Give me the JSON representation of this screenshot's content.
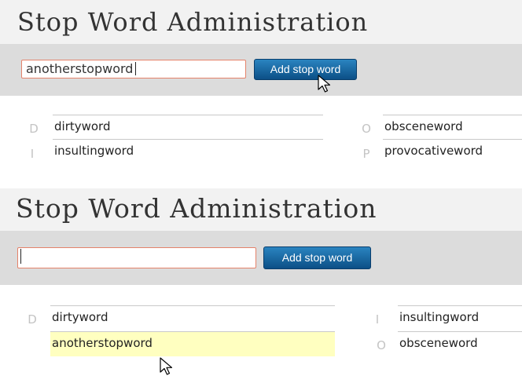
{
  "panels": [
    {
      "title": "Stop Word Administration",
      "input_value": "anotherstopword",
      "add_button_label": "Add stop word",
      "columns": [
        [
          {
            "letter": "D",
            "word": "dirtyword"
          },
          {
            "letter": "I",
            "word": "insultingword"
          }
        ],
        [
          {
            "letter": "O",
            "word": "obsceneword"
          },
          {
            "letter": "P",
            "word": "provocativeword"
          }
        ]
      ]
    },
    {
      "title": "Stop Word Administration",
      "input_value": "",
      "add_button_label": "Add stop word",
      "columns": [
        [
          {
            "letter": "D",
            "word": "dirtyword"
          },
          {
            "letter": "",
            "word": "anotherstopword",
            "highlighted": true
          }
        ],
        [
          {
            "letter": "I",
            "word": "insultingword"
          },
          {
            "letter": "O",
            "word": "obsceneword"
          }
        ]
      ]
    }
  ],
  "colors": {
    "input_border": "#e4826a",
    "button": "#1a639e",
    "highlight": "#ffffc0",
    "bar": "#dcdcdc"
  }
}
